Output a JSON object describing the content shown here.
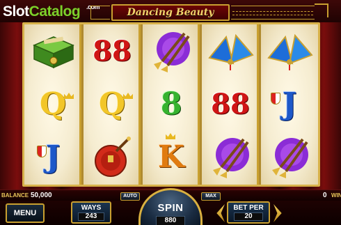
{
  "branding": {
    "slot": "Slot",
    "catalog": "Catalog",
    "com": ".com"
  },
  "game": {
    "title": "Dancing Beauty"
  },
  "reels": [
    [
      {
        "symbol": "green-box-icon"
      },
      {
        "symbol": "Q"
      },
      {
        "symbol": "J"
      }
    ],
    [
      {
        "symbol": "88"
      },
      {
        "symbol": "Q"
      },
      {
        "symbol": "pipa-icon"
      }
    ],
    [
      {
        "symbol": "horns-icon"
      },
      {
        "symbol": "8"
      },
      {
        "symbol": "K"
      }
    ],
    [
      {
        "symbol": "fans-icon"
      },
      {
        "symbol": "88"
      },
      {
        "symbol": "horns-icon"
      }
    ],
    [
      {
        "symbol": "fans-icon"
      },
      {
        "symbol": "J"
      },
      {
        "symbol": "horns-icon"
      }
    ]
  ],
  "status": {
    "balance_label": "BALANCE",
    "balance_value": "50,000",
    "win_value": "0",
    "win_label": "WIN"
  },
  "controls": {
    "menu_label": "MENU",
    "ways_label": "WAYS",
    "ways_value": "243",
    "auto_label": "AUTO",
    "spin_label": "SPIN",
    "spin_value": "880",
    "max_label": "MAX",
    "bet_label": "BET PER",
    "bet_value": "20"
  },
  "colors": {
    "accent_gold": "#c9a030",
    "curtain_red": "#7a0d0d",
    "brand_green": "#7cd02a"
  }
}
